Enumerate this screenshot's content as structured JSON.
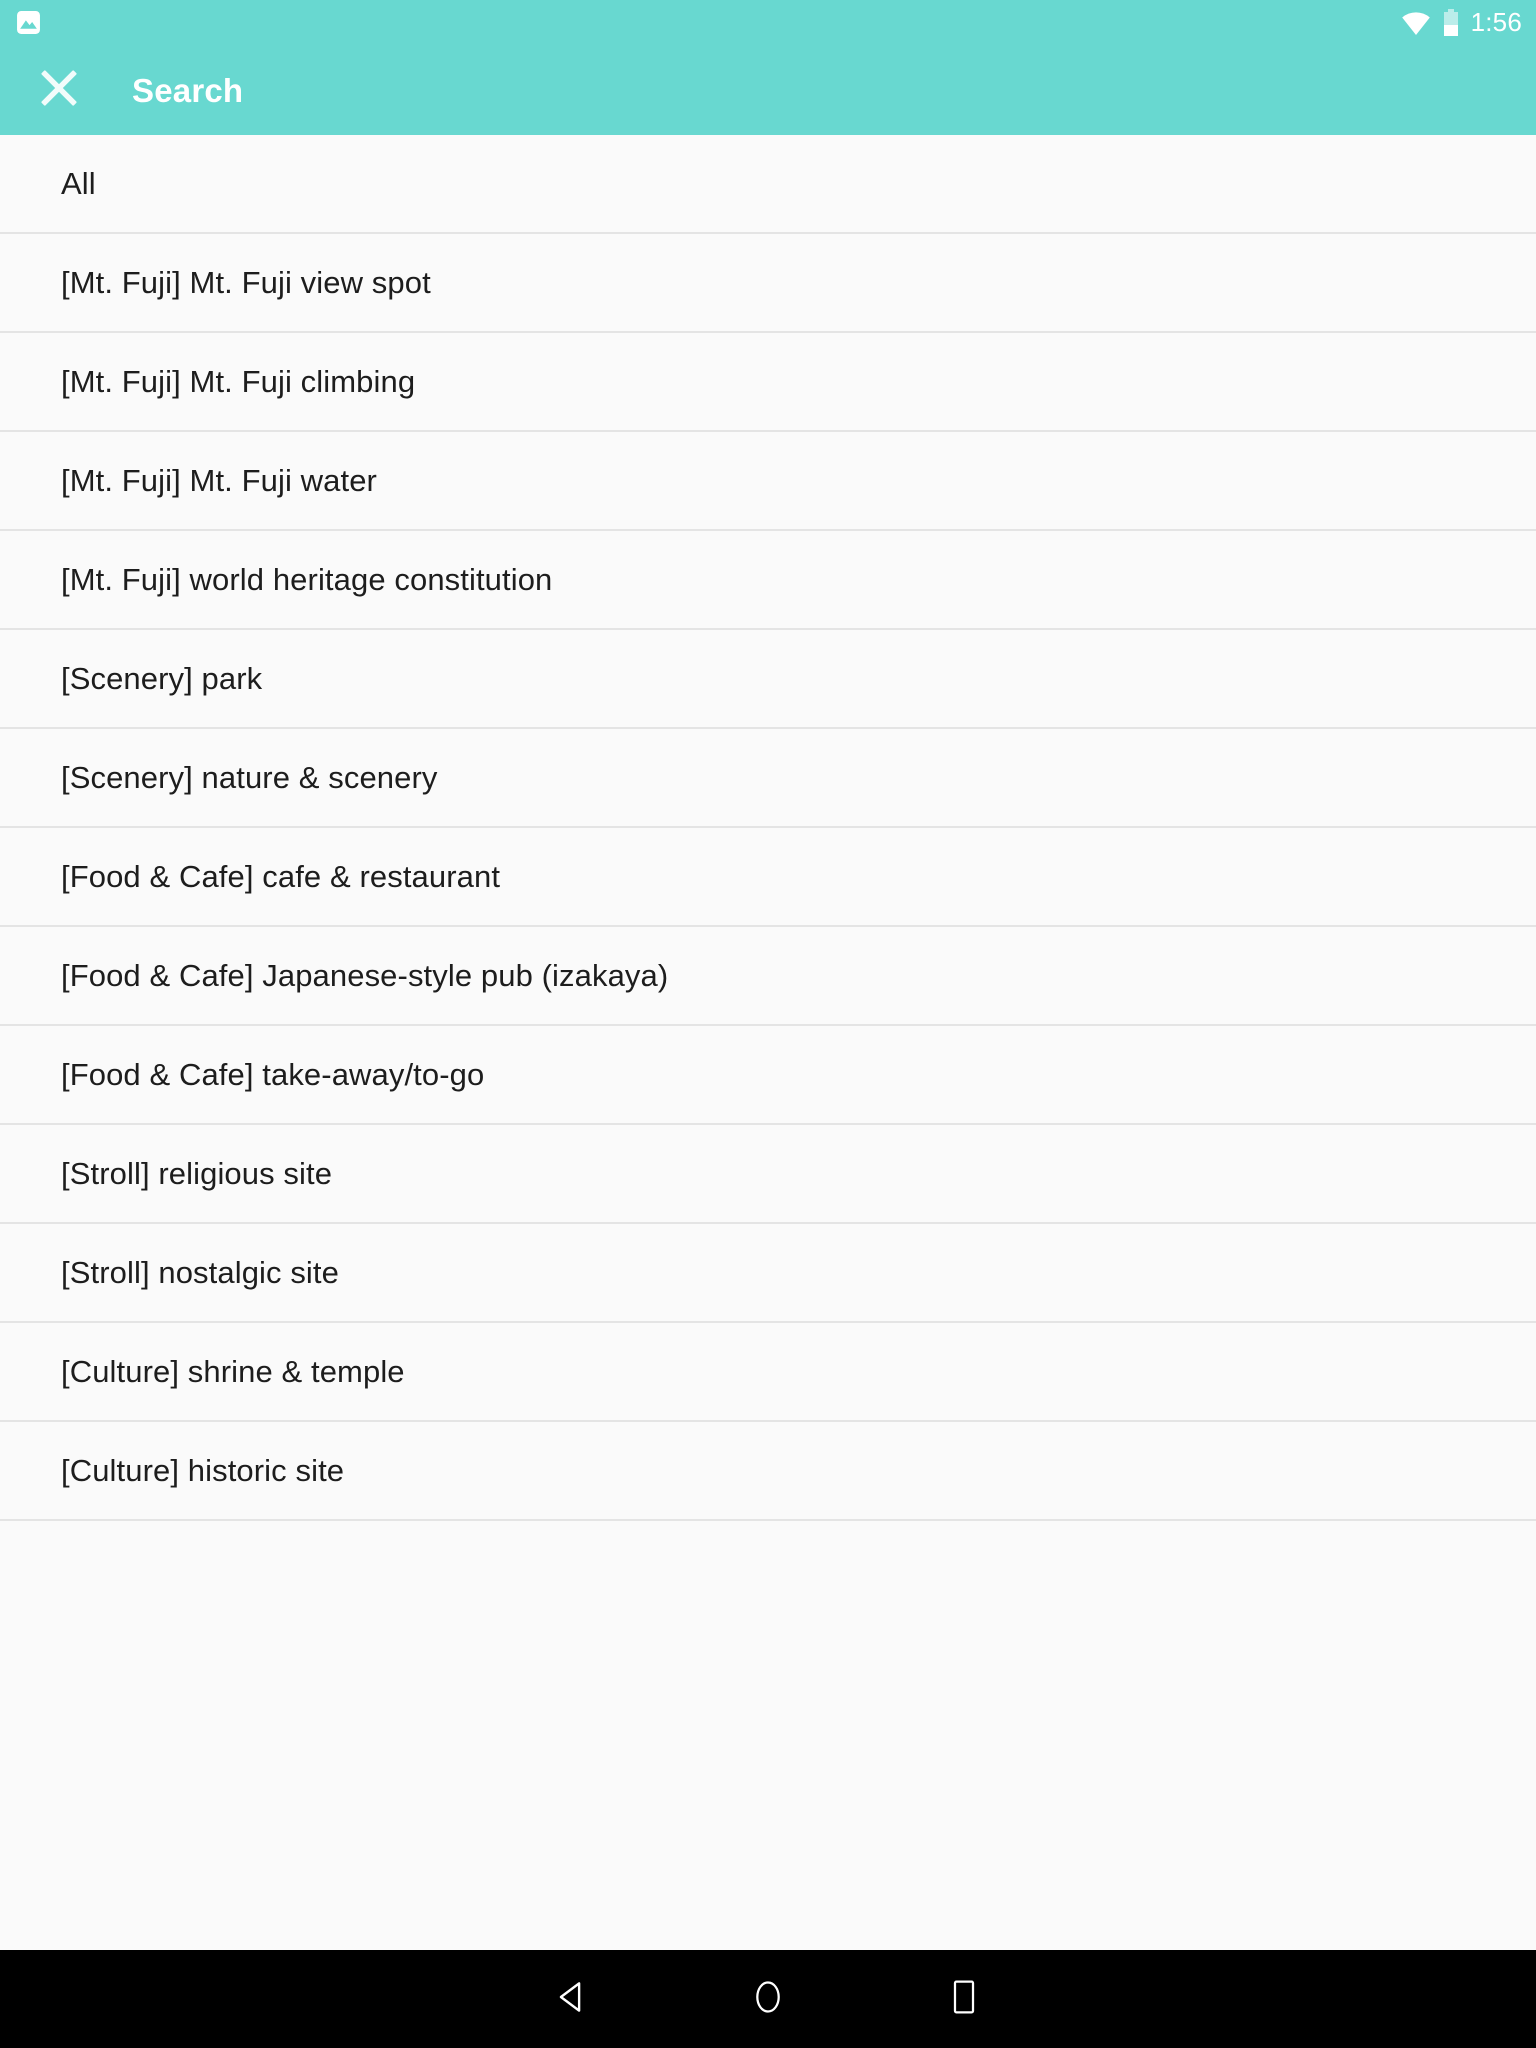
{
  "theme": {
    "accent": "#68D8D0",
    "list_bg": "#FAFAFA",
    "divider": "#E4E4E4",
    "text": "#1d1d1d",
    "nav_bg": "#000000",
    "on_accent": "#FFFFFF"
  },
  "status_bar": {
    "notification_icon": "image-icon",
    "wifi_icon": "wifi-icon",
    "battery_icon": "battery-icon",
    "time": "1:56"
  },
  "app_bar": {
    "close_icon": "close-icon",
    "title": "Search"
  },
  "list": {
    "items": [
      {
        "label": "All"
      },
      {
        "label": "[Mt. Fuji] Mt. Fuji view spot"
      },
      {
        "label": "[Mt. Fuji] Mt. Fuji climbing"
      },
      {
        "label": "[Mt. Fuji] Mt. Fuji water"
      },
      {
        "label": "[Mt. Fuji] world heritage constitution"
      },
      {
        "label": "[Scenery] park"
      },
      {
        "label": "[Scenery] nature & scenery"
      },
      {
        "label": "[Food & Cafe] cafe & restaurant"
      },
      {
        "label": "[Food & Cafe] Japanese-style pub (izakaya)"
      },
      {
        "label": "[Food & Cafe] take-away/to-go"
      },
      {
        "label": "[Stroll] religious site"
      },
      {
        "label": "[Stroll] nostalgic site"
      },
      {
        "label": "[Culture] shrine & temple"
      },
      {
        "label": "[Culture] historic site"
      }
    ]
  },
  "nav_bar": {
    "back_icon": "back-triangle-icon",
    "home_icon": "home-circle-icon",
    "recents_icon": "recents-square-icon"
  }
}
